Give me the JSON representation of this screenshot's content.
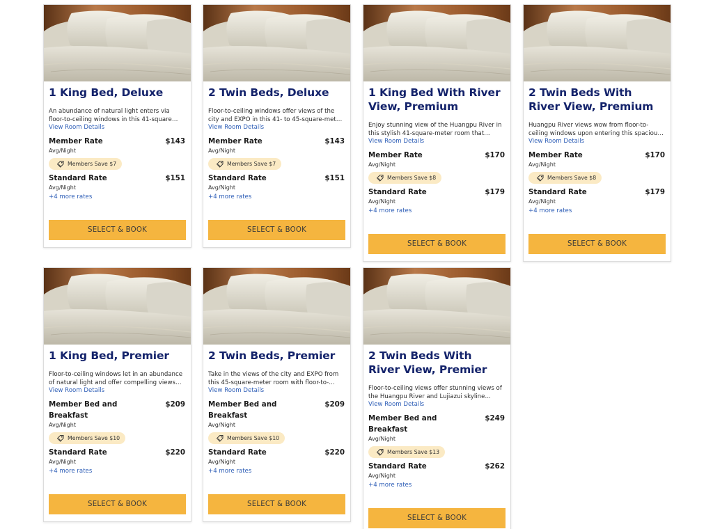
{
  "rooms": [
    {
      "title": "1 King Bed, Deluxe",
      "description": "An abundance of natural light enters via floor-to-ceiling windows in this 41-square meter…",
      "details_link": "View Room Details",
      "member_rate_label": "Member Rate",
      "member_rate_price": "$143",
      "member_unit": "Avg/Night",
      "save_badge": "Members Save $7",
      "standard_rate_label": "Standard Rate",
      "standard_rate_price": "$151",
      "standard_unit": "Avg/Night",
      "more_rates": "+4 more rates",
      "book_label": "SELECT & BOOK"
    },
    {
      "title": "2 Twin Beds, Deluxe",
      "description": "Floor-to-ceiling windows offer views of the city and EXPO in this 41- to 45-square-meter roo…",
      "details_link": "View Room Details",
      "member_rate_label": "Member Rate",
      "member_rate_price": "$143",
      "member_unit": "Avg/Night",
      "save_badge": "Members Save $7",
      "standard_rate_label": "Standard Rate",
      "standard_rate_price": "$151",
      "standard_unit": "Avg/Night",
      "more_rates": "+4 more rates",
      "book_label": "SELECT & BOOK"
    },
    {
      "title": "1 King Bed With River View, Premium",
      "description": "Enjoy stunning view of the Huangpu River in this stylish 41-square-meter room that…",
      "details_link": "View Room Details",
      "member_rate_label": "Member Rate",
      "member_rate_price": "$170",
      "member_unit": "Avg/Night",
      "save_badge": "Members Save $8",
      "standard_rate_label": "Standard Rate",
      "standard_rate_price": "$179",
      "standard_unit": "Avg/Night",
      "more_rates": "+4 more rates",
      "book_label": "SELECT & BOOK"
    },
    {
      "title": "2 Twin Beds With River View, Premium",
      "description": "Huangpu River views wow from floor-to-ceiling windows upon entering this spacious 41-…",
      "details_link": "View Room Details",
      "member_rate_label": "Member Rate",
      "member_rate_price": "$170",
      "member_unit": "Avg/Night",
      "save_badge": "Members Save $8",
      "standard_rate_label": "Standard Rate",
      "standard_rate_price": "$179",
      "standard_unit": "Avg/Night",
      "more_rates": "+4 more rates",
      "book_label": "SELECT & BOOK"
    },
    {
      "title": "1 King Bed, Premier",
      "description": "Floor-to-ceiling windows let in an abundance of natural light and offer compelling views of…",
      "details_link": "View Room Details",
      "member_rate_label": "Member Bed and Breakfast",
      "member_rate_price": "$209",
      "member_unit": "Avg/Night",
      "save_badge": "Members Save $10",
      "standard_rate_label": "Standard Rate",
      "standard_rate_price": "$220",
      "standard_unit": "Avg/Night",
      "more_rates": "+4 more rates",
      "book_label": "SELECT & BOOK"
    },
    {
      "title": "2 Twin Beds, Premier",
      "description": "Take in the views of the city and EXPO from this 45-square-meter room with floor-to-…",
      "details_link": "View Room Details",
      "member_rate_label": "Member Bed and Breakfast",
      "member_rate_price": "$209",
      "member_unit": "Avg/Night",
      "save_badge": "Members Save $10",
      "standard_rate_label": "Standard Rate",
      "standard_rate_price": "$220",
      "standard_unit": "Avg/Night",
      "more_rates": "+4 more rates",
      "book_label": "SELECT & BOOK"
    },
    {
      "title": "2 Twin Beds With River View, Premier",
      "description": "Floor-to-ceiling views offer stunning views of the Huangpu River and Lujiazui skyline from…",
      "details_link": "View Room Details",
      "member_rate_label": "Member Bed and Breakfast",
      "member_rate_price": "$249",
      "member_unit": "Avg/Night",
      "save_badge": "Members Save $13",
      "standard_rate_label": "Standard Rate",
      "standard_rate_price": "$262",
      "standard_unit": "Avg/Night",
      "more_rates": "+4 more rates",
      "book_label": "SELECT & BOOK"
    }
  ],
  "colors": {
    "title": "#14236b",
    "link": "#2f5fb7",
    "button": "#f5b53f",
    "badge": "#fbeac4"
  },
  "icons": {
    "badge": "tag-icon",
    "image": "bed-pillows-photo"
  }
}
